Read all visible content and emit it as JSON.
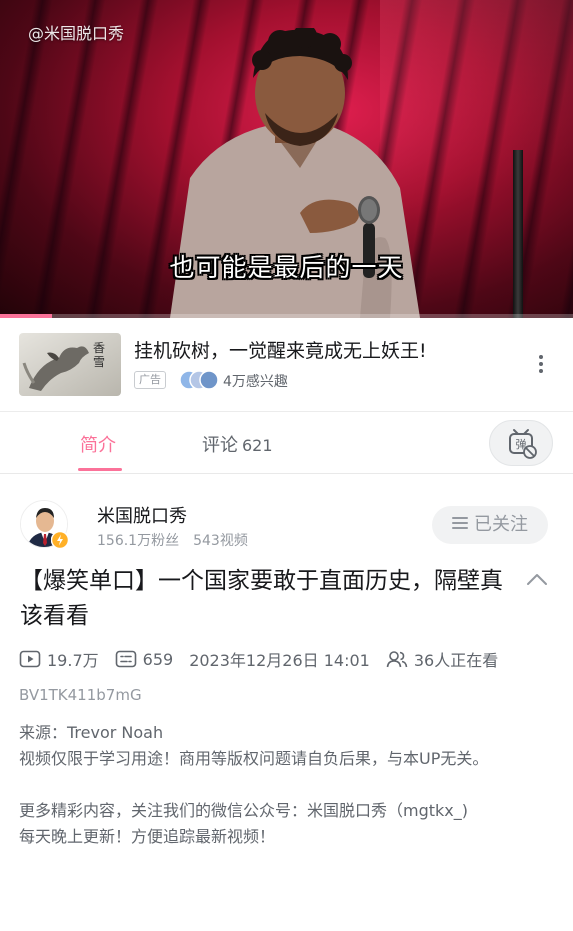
{
  "player": {
    "watermark": "@米国脱口秀",
    "subtitle": "也可能是最后的一天",
    "progress": 0.09,
    "accent_color": "#fb7299"
  },
  "ad": {
    "thumb_text": "香雪",
    "title": "挂机砍树，一觉醒来竟成无上妖王!",
    "badge": "广告",
    "interest": "4万感兴趣",
    "more_icon": "more-vertical-icon"
  },
  "tabs": {
    "intro_label": "简介",
    "comments_label": "评论",
    "comments_count": "621",
    "danmaku_icon": "danmaku-toggle-icon"
  },
  "uploader": {
    "name": "米国脱口秀",
    "fans": "156.1万粉丝",
    "videos": "543视频",
    "follow_label": "已关注"
  },
  "video": {
    "title": "【爆笑单口】一个国家要敢于直面历史，隔壁真该看看",
    "plays": "19.7万",
    "danmaku": "659",
    "date": "2023年12月26日 14:01",
    "watching": "36人正在看",
    "bvid": "BV1TK411b7mG"
  },
  "description": {
    "source": "来源：Trevor Noah",
    "disclaimer": "视频仅限于学习用途！商用等版权问题请自负后果，与本UP无关。",
    "follow_note": "更多精彩内容，关注我们的微信公众号：米国脱口秀（mgtkx_)",
    "update_note": "每天晚上更新！方便追踪最新视频！"
  }
}
